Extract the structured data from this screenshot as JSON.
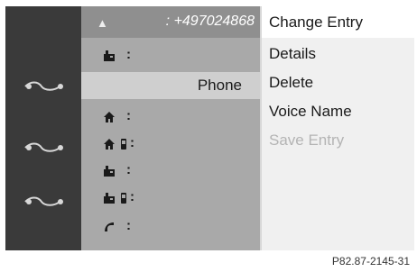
{
  "header": {
    "number": ": +497024868"
  },
  "book": {
    "selected_label": "Phone"
  },
  "menu": {
    "title": "Change Entry",
    "items": [
      "Details",
      "Delete",
      "Voice Name",
      "Save Entry"
    ]
  },
  "caption": "P82.87-2145-31",
  "colors": {
    "binder": "#3a3a3a",
    "screen": "#a9a9a9",
    "menu": "#f0f0f0",
    "disabled": "#b4b4b4"
  },
  "icons": [
    "person-icon",
    "office-phone-icon",
    "home-icon",
    "mobile-icon",
    "handset-icon",
    "binder-ring-icon"
  ]
}
